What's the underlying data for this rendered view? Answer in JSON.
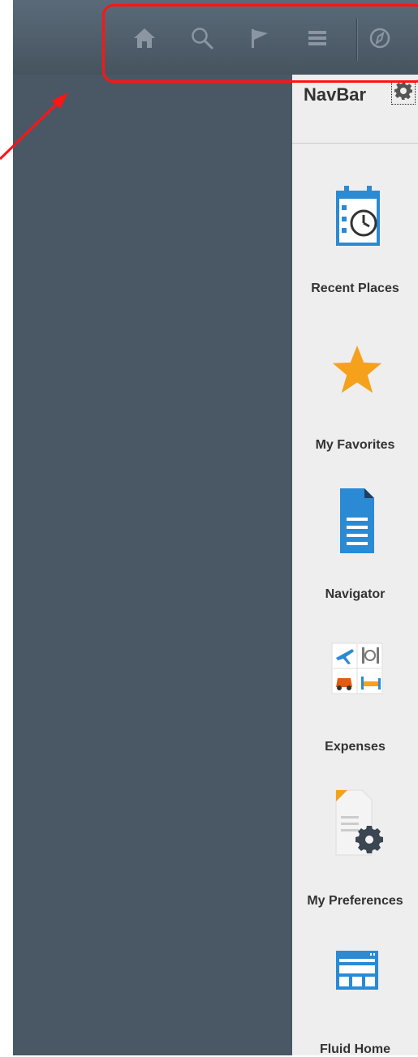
{
  "header": {
    "toolbar": [
      {
        "name": "home-icon",
        "icon": "home-icon"
      },
      {
        "name": "search-icon",
        "icon": "search-icon"
      },
      {
        "name": "flag-icon",
        "icon": "flag-icon"
      },
      {
        "name": "menu-icon",
        "icon": "menu-icon"
      },
      {
        "name": "compass-icon",
        "icon": "compass-icon"
      }
    ]
  },
  "navbar": {
    "title": "NavBar",
    "items": [
      {
        "label": "Recent Places",
        "icon": "calendar-clock-icon"
      },
      {
        "label": "My Favorites",
        "icon": "star-icon"
      },
      {
        "label": "Navigator",
        "icon": "document-icon"
      },
      {
        "label": "Expenses",
        "icon": "expenses-icon"
      },
      {
        "label": "My Preferences",
        "icon": "preferences-icon"
      },
      {
        "label": "Fluid Home",
        "icon": "fluid-home-icon"
      }
    ]
  },
  "colors": {
    "panel": "#4a5866",
    "header": "#5b6a79",
    "navbar_bg": "#eeeeee",
    "annotation": "#ff1414",
    "accent_blue": "#2a8ad4",
    "star": "#f5a11c"
  }
}
